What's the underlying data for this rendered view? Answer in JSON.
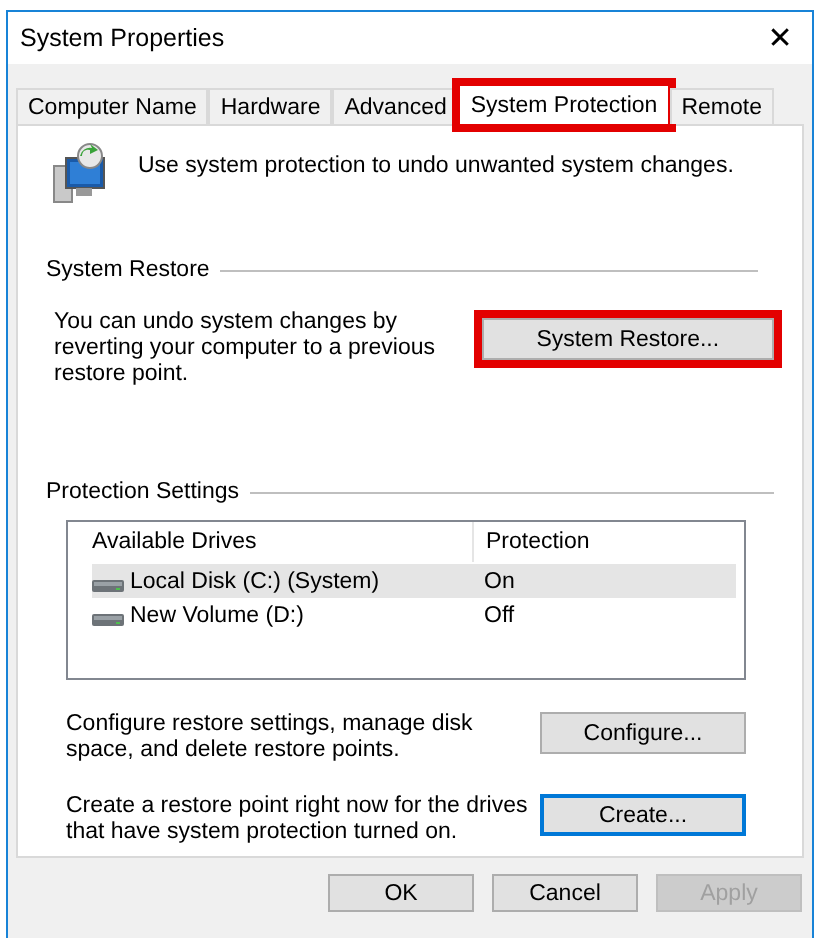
{
  "window": {
    "title": "System Properties",
    "close": "✕"
  },
  "tabs": [
    {
      "label": "Computer Name",
      "selected": false,
      "highlighted": false
    },
    {
      "label": "Hardware",
      "selected": false,
      "highlighted": false
    },
    {
      "label": "Advanced",
      "selected": false,
      "highlighted": false
    },
    {
      "label": "System Protection",
      "selected": true,
      "highlighted": true
    },
    {
      "label": "Remote",
      "selected": false,
      "highlighted": false
    }
  ],
  "intro": "Use system protection to undo unwanted system changes.",
  "system_restore": {
    "heading": "System Restore",
    "text": "You can undo system changes by reverting your computer to a previous restore point.",
    "button": {
      "label": "System Restore...",
      "highlighted": true,
      "focused": false
    }
  },
  "protection_settings": {
    "heading": "Protection Settings",
    "columns": [
      "Available Drives",
      "Protection"
    ],
    "rows": [
      {
        "drive": "Local Disk (C:) (System)",
        "protection": "On",
        "selected": true
      },
      {
        "drive": "New Volume (D:)",
        "protection": "Off",
        "selected": false
      }
    ],
    "actions": [
      {
        "text": "Configure restore settings, manage disk space, and delete restore points.",
        "button": {
          "label": "Configure...",
          "highlighted": false,
          "focused": false
        }
      },
      {
        "text": "Create a restore point right now for the drives that have system protection turned on.",
        "button": {
          "label": "Create...",
          "highlighted": false,
          "focused": true
        }
      }
    ]
  },
  "buttons": [
    {
      "label": "OK",
      "disabled": false
    },
    {
      "label": "Cancel",
      "disabled": false
    },
    {
      "label": "Apply",
      "disabled": true
    }
  ]
}
